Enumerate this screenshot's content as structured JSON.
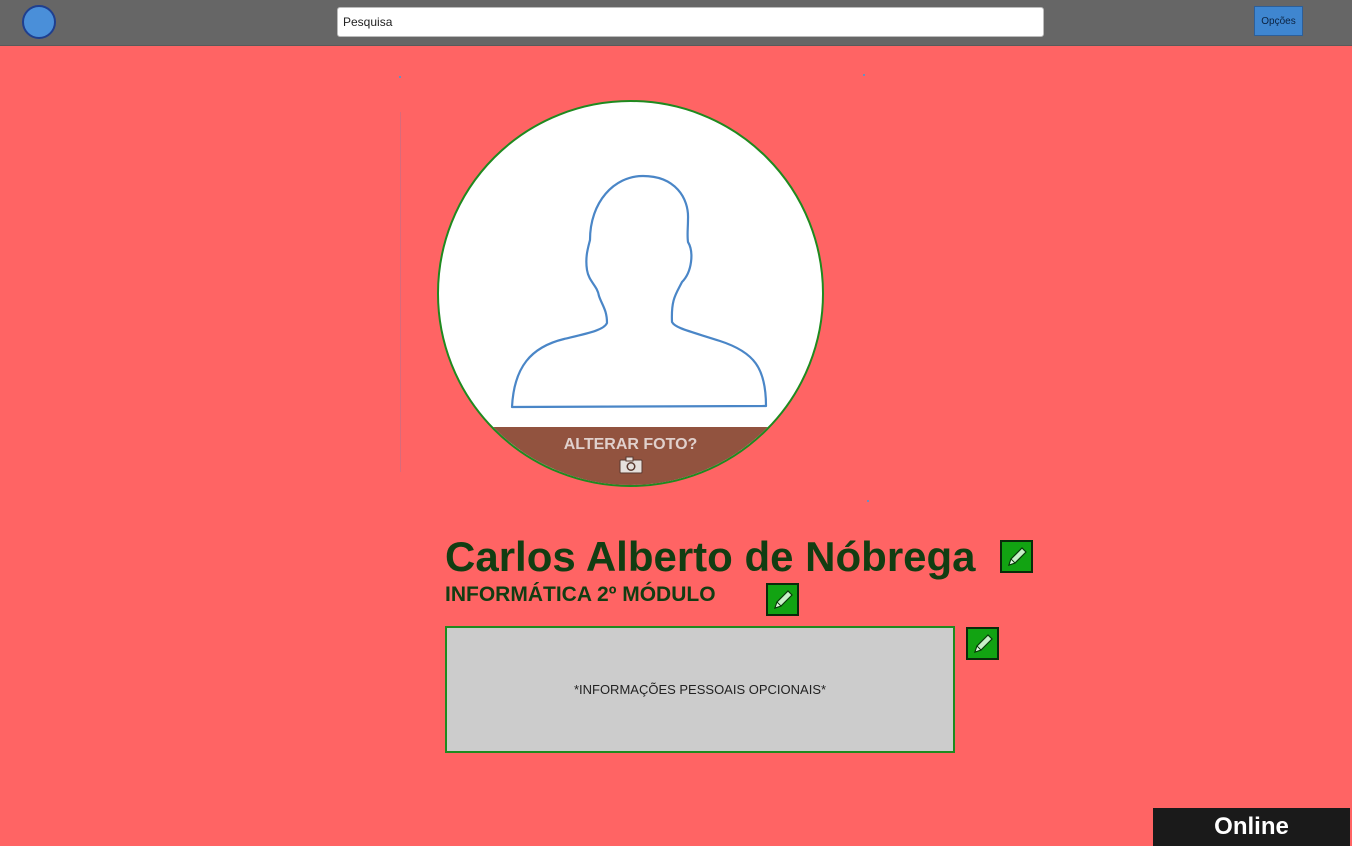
{
  "header": {
    "search_placeholder": "Pesquisa",
    "options_label": "Opções"
  },
  "profile": {
    "change_photo_label": "ALTERAR FOTO?",
    "name": "Carlos Alberto de Nóbrega",
    "course": "INFORMÁTICA 2º MÓDULO",
    "info_placeholder": "*INFORMAÇÕES PESSOAIS OPCIONAIS*"
  },
  "status": {
    "label": "Online"
  },
  "icons": {
    "logo": "circle-logo-icon",
    "avatar": "user-silhouette-icon",
    "camera": "camera-icon",
    "edit": "pencil-icon"
  },
  "colors": {
    "page_background": "#ff6464",
    "topbar": "#666666",
    "accent_green": "#12a312",
    "button_blue": "#3f86d0",
    "photo_overlay": "#92533f",
    "status_background": "#1a1a1a"
  }
}
